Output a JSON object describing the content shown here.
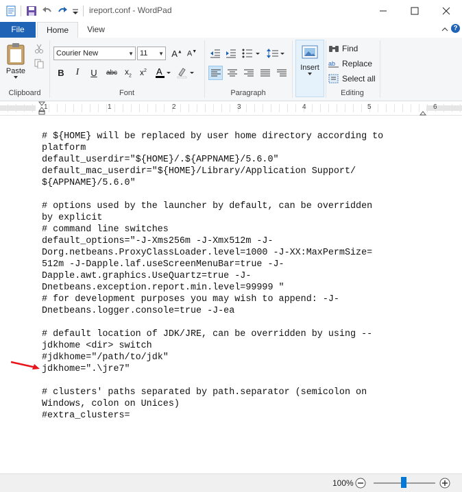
{
  "window": {
    "title": "ireport.conf - WordPad",
    "controls": [
      "minimize-icon",
      "maximize-icon",
      "close-icon"
    ]
  },
  "quick_access": [
    "wordpad-icon",
    "save-icon",
    "undo-icon",
    "redo-icon",
    "customize-dropdown-icon"
  ],
  "ribbon_tabs": [
    {
      "label": "File"
    },
    {
      "label": "Home"
    },
    {
      "label": "View"
    }
  ],
  "ribbon": {
    "clipboard": {
      "paste_label": "Paste",
      "group_label": "Clipboard"
    },
    "font": {
      "family": "Courier New",
      "size": "11",
      "group_label": "Font"
    },
    "paragraph": {
      "group_label": "Paragraph"
    },
    "insert": {
      "label": "Insert"
    },
    "editing": {
      "find": "Find",
      "replace": "Replace",
      "select_all": "Select all",
      "group_label": "Editing"
    }
  },
  "ruler": {
    "numbers": [
      "1",
      "1",
      "2",
      "3",
      "4",
      "5",
      "6"
    ]
  },
  "document": {
    "lines": [
      "# ${HOME} will be replaced by user home directory according to",
      "platform",
      "default_userdir=\"${HOME}/.${APPNAME}/5.6.0\"",
      "default_mac_userdir=\"${HOME}/Library/Application Support/",
      "${APPNAME}/5.6.0\"",
      "",
      "# options used by the launcher by default, can be overridden",
      "by explicit",
      "# command line switches",
      "default_options=\"-J-Xms256m -J-Xmx512m -J-",
      "Dorg.netbeans.ProxyClassLoader.level=1000 -J-XX:MaxPermSize=",
      "512m -J-Dapple.laf.useScreenMenuBar=true -J-",
      "Dapple.awt.graphics.UseQuartz=true -J-",
      "Dnetbeans.exception.report.min.level=99999 \"",
      "# for development purposes you may wish to append: -J-",
      "Dnetbeans.logger.console=true -J-ea",
      "",
      "# default location of JDK/JRE, can be overridden by using --",
      "jdkhome <dir> switch",
      "#jdkhome=\"/path/to/jdk\"",
      "jdkhome=\".\\jre7\"",
      "",
      "# clusters' paths separated by path.separator (semicolon on",
      "Windows, colon on Unices)",
      "#extra_clusters="
    ]
  },
  "status": {
    "zoom": "100%"
  },
  "colors": {
    "accent": "#1e63b6",
    "arrow": "#e8141c",
    "slider": "#0078d7"
  }
}
